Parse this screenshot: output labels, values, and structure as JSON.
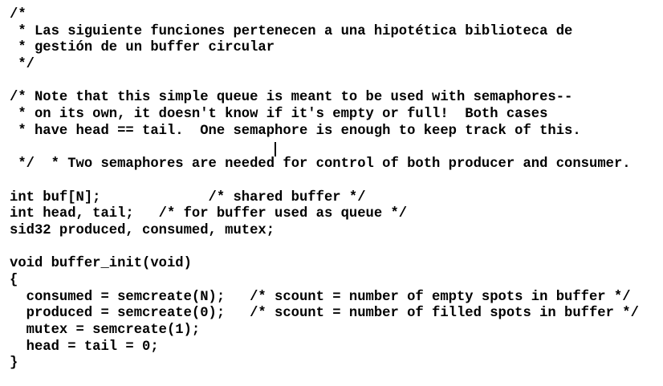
{
  "editor": {
    "lines": [
      "/*",
      " * Las siguiente funciones pertenecen a una hipotética biblioteca de",
      " * gestión de un buffer circular",
      " */",
      "",
      "/* Note that this simple queue is meant to be used with semaphores--",
      " * on its own, it doesn't know if it's empty or full!  Both cases",
      " * have head == tail.  One semaphore is enough to keep track of this.",
      " * Two semaphores are needed for control of both producer and consumer.",
      " */",
      "",
      "int buf[N];             /* shared buffer */",
      "int head, tail;   /* for buffer used as queue */",
      "sid32 produced, consumed, mutex;",
      "",
      "void buffer_init(void)",
      "{",
      "  consumed = semcreate(N);   /* scount = number of empty spots in buffer */",
      "  produced = semcreate(0);   /* scount = number of filled spots in buffer */",
      "  mutex = semcreate(1);",
      "  head = tail = 0;",
      "}"
    ],
    "caret": {
      "line": 8,
      "column": 32
    }
  }
}
